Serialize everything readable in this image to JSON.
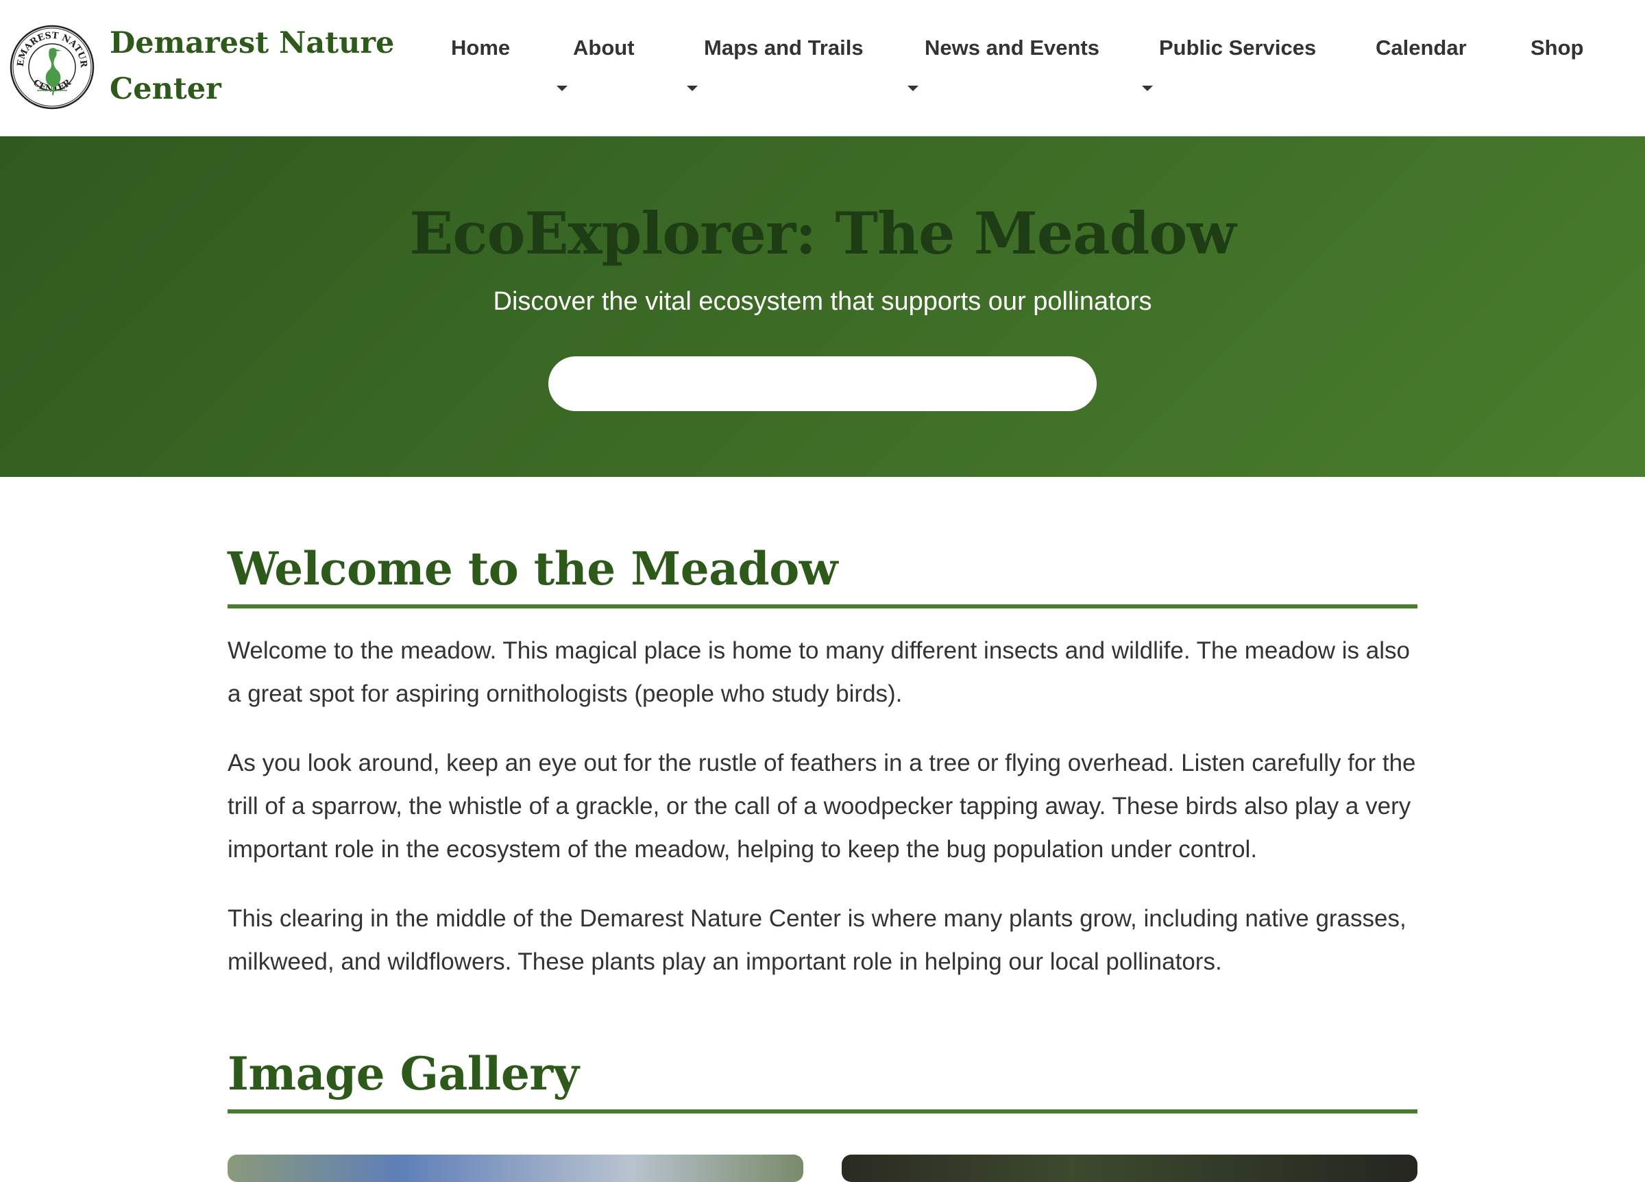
{
  "header": {
    "site_name": "Demarest Nature Center",
    "logo": {
      "icon": "heron-seal-icon",
      "seal_text_top": "DEMAREST NATURE",
      "seal_text_bottom": "CENTER"
    }
  },
  "nav": {
    "items": [
      {
        "label": "Home",
        "has_dropdown": false
      },
      {
        "label": "About",
        "has_dropdown": true
      },
      {
        "label": "Maps and Trails",
        "has_dropdown": true
      },
      {
        "label": "News and Events",
        "has_dropdown": true
      },
      {
        "label": "Public Services",
        "has_dropdown": true
      },
      {
        "label": "Calendar",
        "has_dropdown": false
      },
      {
        "label": "Shop",
        "has_dropdown": false
      }
    ]
  },
  "hero": {
    "title": "EcoExplorer: The Meadow",
    "subtitle": "Discover the vital ecosystem that supports our pollinators",
    "cta_label": ""
  },
  "welcome": {
    "title": "Welcome to the Meadow",
    "paragraphs": [
      "Welcome to the meadow. This magical place is home to many different insects and wildlife. The meadow is also a great spot for aspiring ornithologists (people who study birds).",
      "As you look around, keep an eye out for the rustle of feathers in a tree or flying overhead. Listen carefully for the trill of a sparrow, the whistle of a grackle, or the call of a woodpecker tapping away. These birds also play a very important role in the ecosystem of the meadow, helping to keep the bug population under control.",
      "This clearing in the middle of the Demarest Nature Center is where many plants grow, including native grasses, milkweed, and wildflowers. These plants play an important role in helping our local pollinators."
    ]
  },
  "gallery": {
    "title": "Image Gallery"
  },
  "colors": {
    "brand_green": "#2d5a1b",
    "hero_green": "#3b6a25",
    "accent_rule": "#4a7d2d",
    "hero_title": "#1e3d15",
    "body_text": "#333333"
  }
}
